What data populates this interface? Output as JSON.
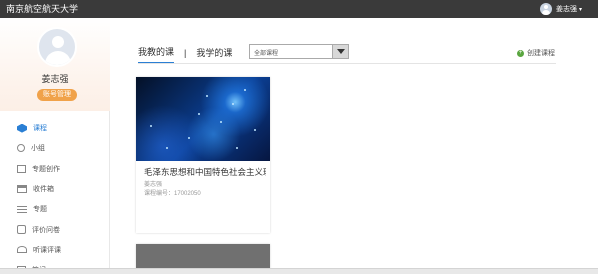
{
  "header": {
    "school_name": "南京航空航天大学",
    "user_name": "姜志强",
    "user_menu_icon": "chevron-down-icon"
  },
  "sidebar": {
    "profile": {
      "name": "姜志强",
      "account_button": "账号管理"
    },
    "items": [
      {
        "label": "课程",
        "icon": "course-icon",
        "active": true
      },
      {
        "label": "小组",
        "icon": "group-icon"
      },
      {
        "label": "专题创作",
        "icon": "create-topic-icon"
      },
      {
        "label": "收件箱",
        "icon": "inbox-icon"
      },
      {
        "label": "专题",
        "icon": "topic-icon"
      },
      {
        "label": "评价问卷",
        "icon": "survey-icon"
      },
      {
        "label": "听课评课",
        "icon": "observe-icon"
      },
      {
        "label": "笔记",
        "icon": "notes-icon"
      }
    ]
  },
  "main": {
    "tabs": [
      {
        "label": "我教的课",
        "active": true
      },
      {
        "label": "我学的课"
      }
    ],
    "tab_separator": "|",
    "filter": {
      "selected": "全部课程"
    },
    "create_course": "创建课程",
    "courses": [
      {
        "title": "毛泽东思想和中国特色社会主义理...",
        "teacher": "姜志强",
        "code": "课程编号：17002050"
      }
    ]
  },
  "colors": {
    "accent": "#2a7fd4",
    "account_button": "#f0a24a",
    "topbar": "#3a3a3a",
    "create_icon": "#5aa640"
  }
}
